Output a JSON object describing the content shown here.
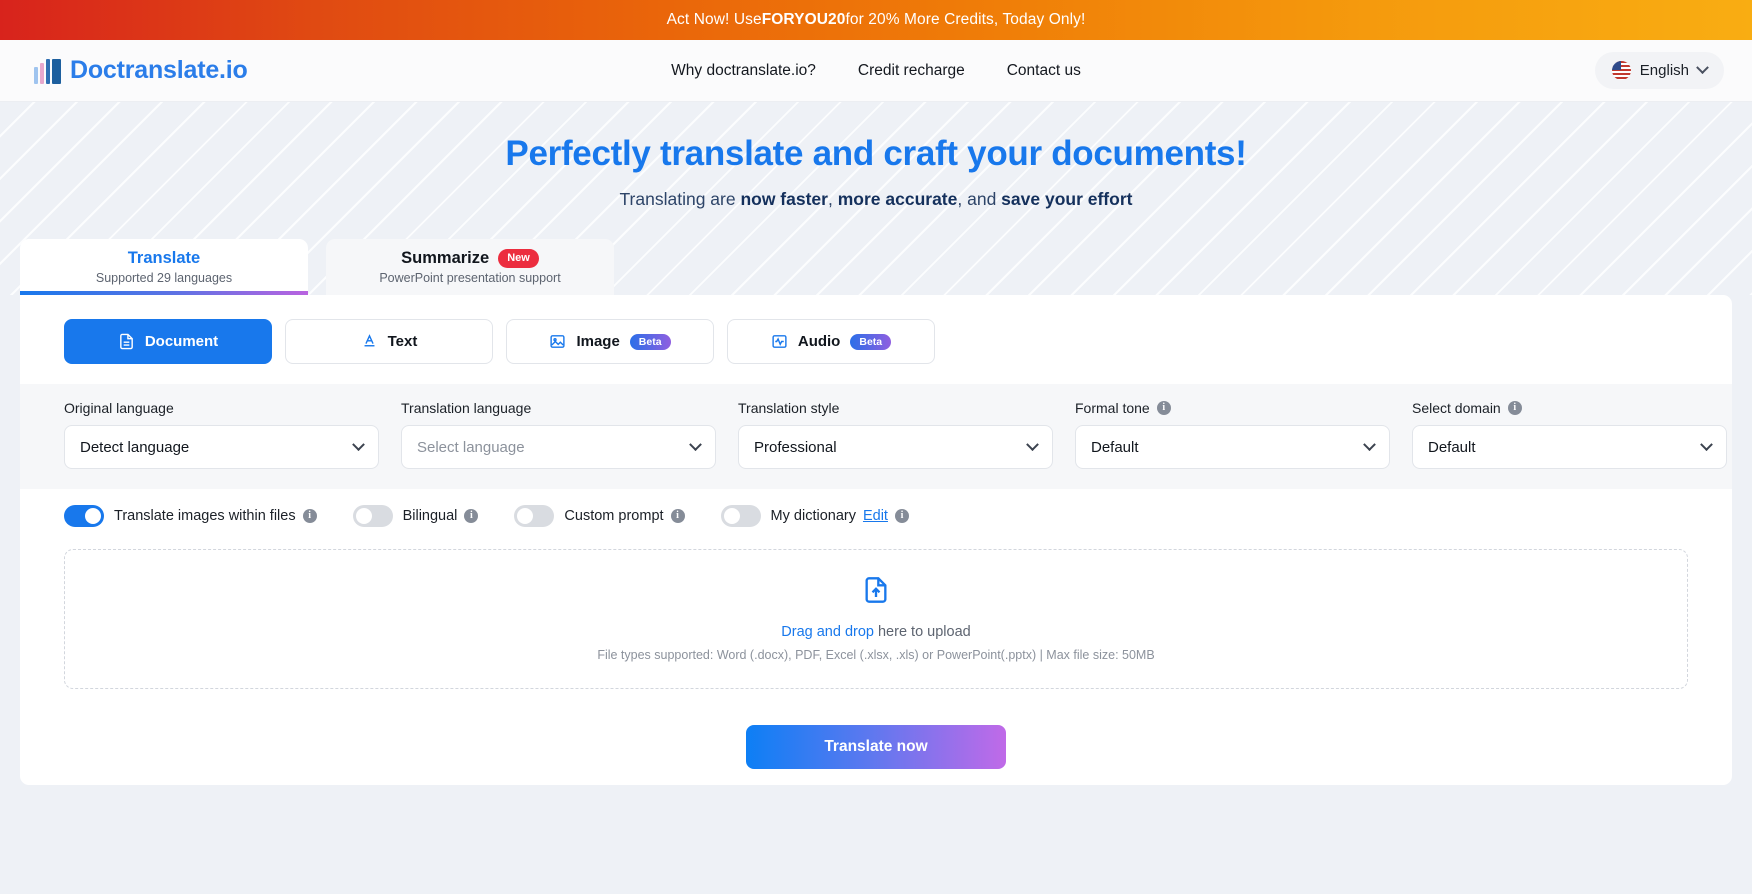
{
  "promo": {
    "prefix": "Act Now! Use ",
    "code": "FORYOU20",
    "suffix": " for 20% More Credits, Today Only!"
  },
  "header": {
    "logo_text": "Doctranslate.io",
    "nav": [
      {
        "label": "Why doctranslate.io?"
      },
      {
        "label": "Credit recharge"
      },
      {
        "label": "Contact us"
      }
    ],
    "language": {
      "label": "English",
      "flag": "us-flag-icon",
      "chevron": "chevron-down-icon"
    }
  },
  "hero": {
    "title": "Perfectly translate and craft your documents!",
    "subtitle_1": "Translating are ",
    "subtitle_b1": "now faster",
    "subtitle_2": ", ",
    "subtitle_b2": "more accurate",
    "subtitle_3": ", and ",
    "subtitle_b3": "save your effort"
  },
  "tabs": [
    {
      "title": "Translate",
      "sub": "Supported 29 languages",
      "active": true,
      "badge": ""
    },
    {
      "title": "Summarize",
      "sub": "PowerPoint presentation support",
      "active": false,
      "badge": "New"
    }
  ],
  "modes": [
    {
      "label": "Document",
      "icon": "document-icon",
      "badge": "",
      "active": true
    },
    {
      "label": "Text",
      "icon": "text-icon",
      "badge": "",
      "active": false
    },
    {
      "label": "Image",
      "icon": "image-icon",
      "badge": "Beta",
      "active": false
    },
    {
      "label": "Audio",
      "icon": "audio-icon",
      "badge": "Beta",
      "active": false
    }
  ],
  "fields": [
    {
      "label": "Original language",
      "value": "Detect language",
      "placeholder": false,
      "info": false
    },
    {
      "label": "Translation language",
      "value": "Select language",
      "placeholder": true,
      "info": false
    },
    {
      "label": "Translation style",
      "value": "Professional",
      "placeholder": false,
      "info": false
    },
    {
      "label": "Formal tone",
      "value": "Default",
      "placeholder": false,
      "info": true
    },
    {
      "label": "Select domain",
      "value": "Default",
      "placeholder": false,
      "info": true
    }
  ],
  "toggles": [
    {
      "label": "Translate images within files",
      "on": true,
      "link": ""
    },
    {
      "label": "Bilingual",
      "on": false,
      "link": ""
    },
    {
      "label": "Custom prompt",
      "on": false,
      "link": ""
    },
    {
      "label": "My dictionary",
      "on": false,
      "link": "Edit"
    }
  ],
  "dropzone": {
    "icon": "file-upload-icon",
    "link": "Drag and drop",
    "title_rest": " here to upload",
    "sub": "File types supported: Word (.docx), PDF, Excel (.xlsx, .xls) or PowerPoint(.pptx) | Max file size: 50MB"
  },
  "cta": {
    "label": "Translate now"
  },
  "colors": {
    "brand_blue": "#1878ec",
    "gradient_purple": "#c06ae8",
    "badge_new_red": "#ec2d3f",
    "promo_red": "#d8231c",
    "promo_orange": "#f9ad12"
  }
}
